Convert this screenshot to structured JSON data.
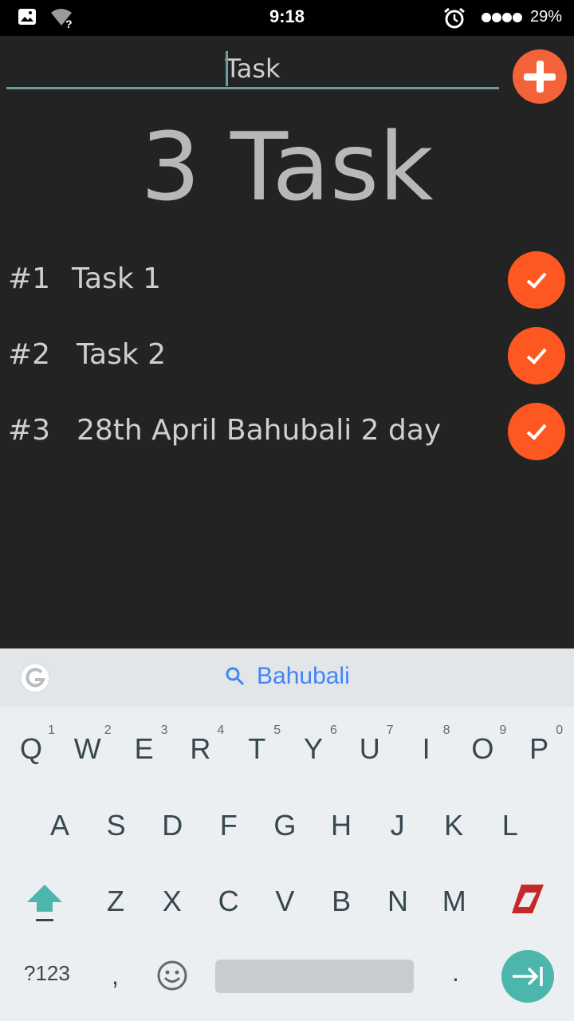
{
  "status_bar": {
    "time": "9:18",
    "battery": "29%",
    "icons": [
      "gallery-icon",
      "wifi-unknown-icon",
      "alarm-icon",
      "signal-icon"
    ]
  },
  "input": {
    "value": "Task",
    "placeholder": ""
  },
  "add_button": {
    "icon": "plus-icon",
    "color": "#f4623a"
  },
  "count_title": "3 Task",
  "tasks": [
    {
      "num": "#1",
      "text": "Task 1"
    },
    {
      "num": "#2",
      "text": "Task 2"
    },
    {
      "num": "#3",
      "text": "28th April Bahubali 2 day"
    }
  ],
  "done_color": "#ff5722",
  "keyboard": {
    "suggestion": "Bahubali",
    "row1": [
      "Q",
      "W",
      "E",
      "R",
      "T",
      "Y",
      "U",
      "I",
      "O",
      "P"
    ],
    "row1_hints": [
      "1",
      "2",
      "3",
      "4",
      "5",
      "6",
      "7",
      "8",
      "9",
      "0"
    ],
    "row2": [
      "A",
      "S",
      "D",
      "F",
      "G",
      "H",
      "J",
      "K",
      "L"
    ],
    "row3": [
      "Z",
      "X",
      "C",
      "V",
      "B",
      "N",
      "M"
    ],
    "symbols_label": "?123",
    "comma": ",",
    "period": "."
  }
}
